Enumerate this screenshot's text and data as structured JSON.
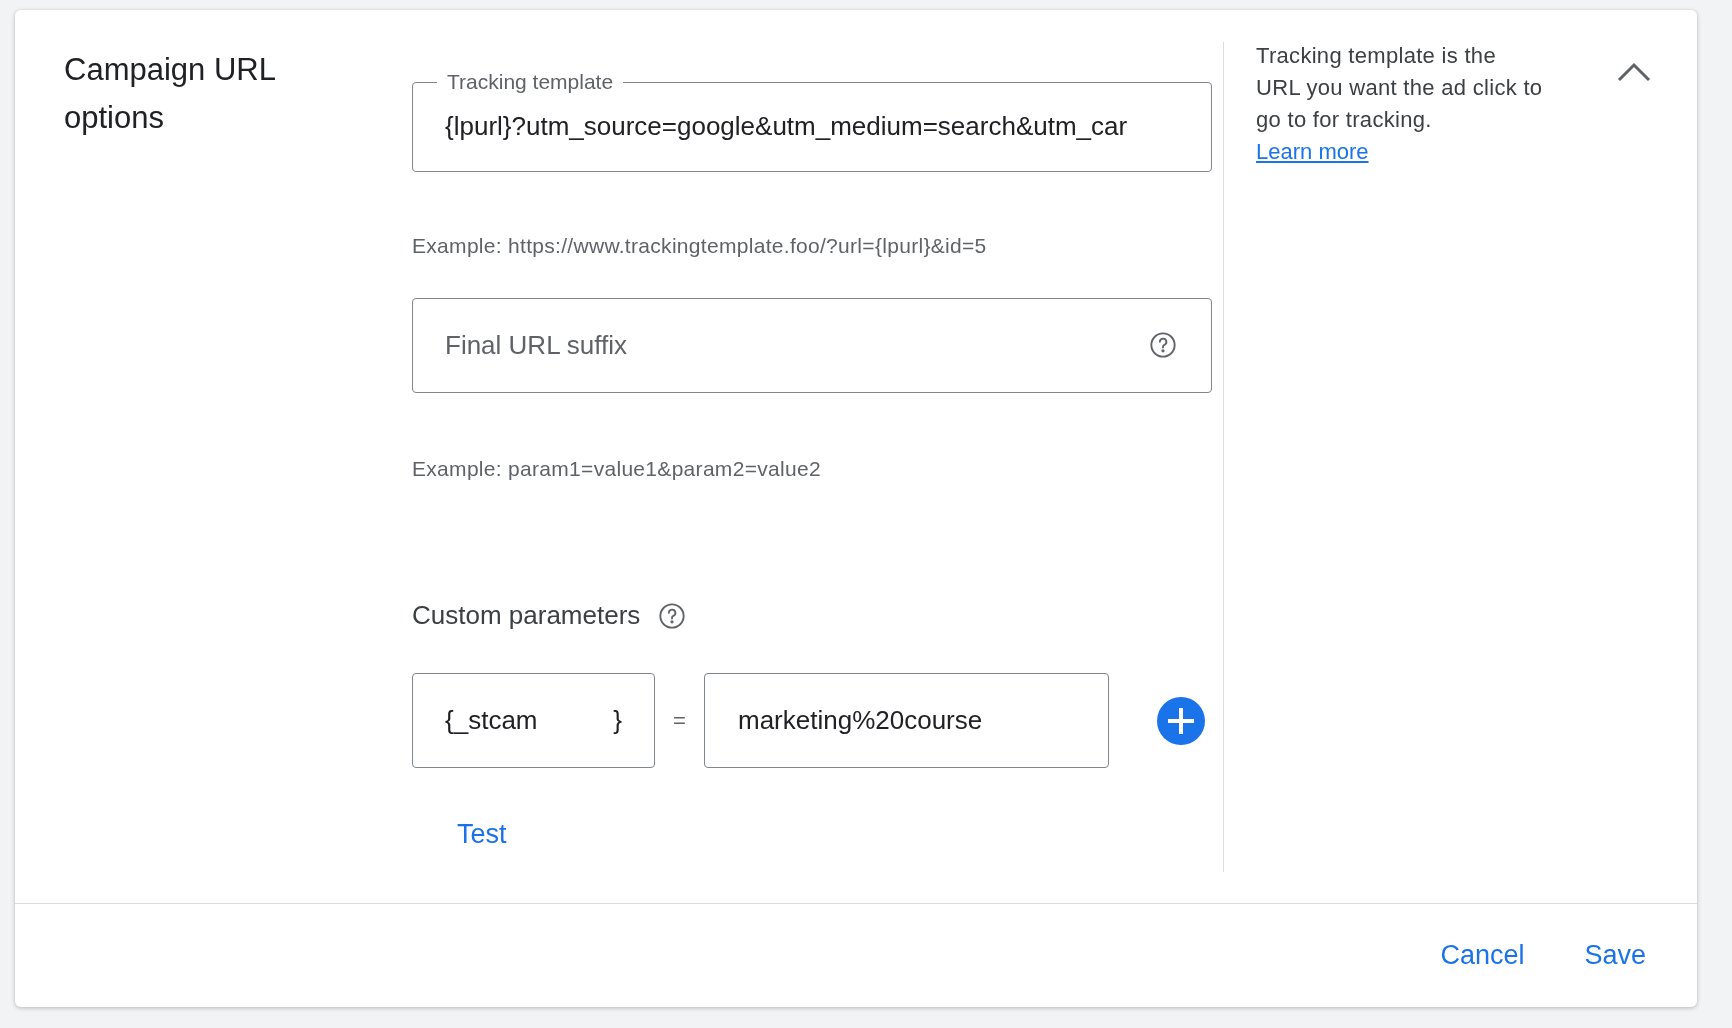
{
  "title": "Campaign URL options",
  "tracking_template": {
    "label": "Tracking template",
    "value": "{lpurl}?utm_source=google&utm_medium=search&utm_car",
    "example": "Example: https://www.trackingtemplate.foo/?url={lpurl}&id=5"
  },
  "final_url_suffix": {
    "placeholder": "Final URL suffix",
    "example": "Example: param1=value1&param2=value2"
  },
  "custom_parameters": {
    "label": "Custom parameters",
    "key_open": "{_",
    "key": "stcam",
    "key_close": "}",
    "equals": "=",
    "value": "marketing%20course"
  },
  "test_button": "Test",
  "help": {
    "text": "Tracking template is the URL you want the ad click to go to for tracking.",
    "link": "Learn more",
    "expanded": true
  },
  "footer": {
    "buttons": [
      "Cancel",
      "Save"
    ]
  }
}
